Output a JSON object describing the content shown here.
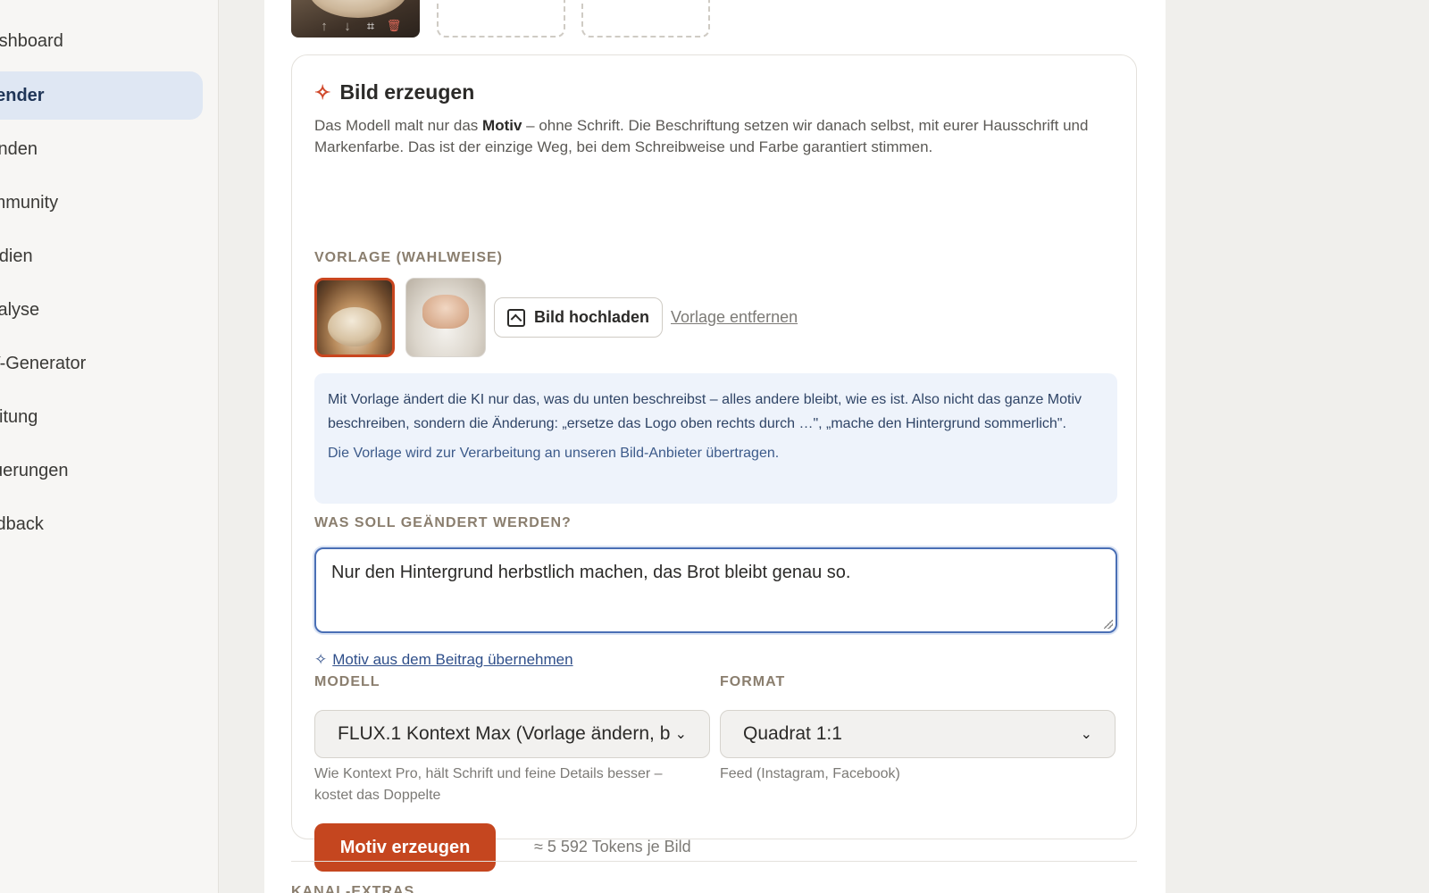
{
  "sidebar": {
    "items": [
      {
        "label": "Dashboard"
      },
      {
        "label": "Kalender"
      },
      {
        "label": "Kunden"
      },
      {
        "label": "Community"
      },
      {
        "label": "Medien"
      },
      {
        "label": "Analyse"
      },
      {
        "label": "KV-Generator"
      },
      {
        "label": "Anleitung"
      },
      {
        "label": "Steuerungen"
      },
      {
        "label": "Feedback"
      }
    ],
    "active_index": 1
  },
  "thumb_tools": {
    "up": "↑",
    "down": "↓",
    "crop": "⌗",
    "delete": "🗑"
  },
  "card": {
    "title": "Bild erzeugen",
    "desc_before": "Das Modell malt nur das ",
    "desc_bold": "Motiv",
    "desc_after": " – ohne Schrift. Die Beschriftung setzen wir danach selbst, mit eurer Hausschrift und Markenfarbe. Das ist der einzige Weg, bei dem Schreibweise und Farbe garantiert stimmen.",
    "template_label": "VORLAGE (WAHLWEISE)",
    "upload_label": "Bild hochladen",
    "remove_label": "Vorlage entfernen",
    "info_p1": "Mit Vorlage ändert die KI nur das, was du unten beschreibst – alles andere bleibt, wie es ist. Also nicht das ganze Motiv beschreiben, sondern die Änderung: „ersetze das Logo oben rechts durch …\", „mache den Hintergrund sommerlich\".",
    "info_p2": "Die Vorlage wird zur Verarbeitung an unseren Bild-Anbieter übertragen.",
    "change_label": "WAS SOLL GEÄNDERT WERDEN?",
    "change_value": "Nur den Hintergrund herbstlich machen, das Brot bleibt genau so.",
    "motiv_link": "Motiv aus dem Beitrag übernehmen",
    "model_label": "MODELL",
    "model_value": "FLUX.1 Kontext Max (Vorlage ändern, b",
    "model_help": "Wie Kontext Pro, hält Schrift und feine Details besser – kostet das Doppelte",
    "format_label": "FORMAT",
    "format_value": "Quadrat 1:1",
    "format_help": "Feed (Instagram, Facebook)",
    "generate_label": "Motiv erzeugen",
    "token_text": "≈ 5 592 Tokens je Bild"
  },
  "next_section": "KANAL-EXTRAS",
  "colors": {
    "accent": "#c5461f",
    "active_nav": "#dfe7f3",
    "link": "#2f4f8a",
    "focus": "#4a6fb5"
  }
}
